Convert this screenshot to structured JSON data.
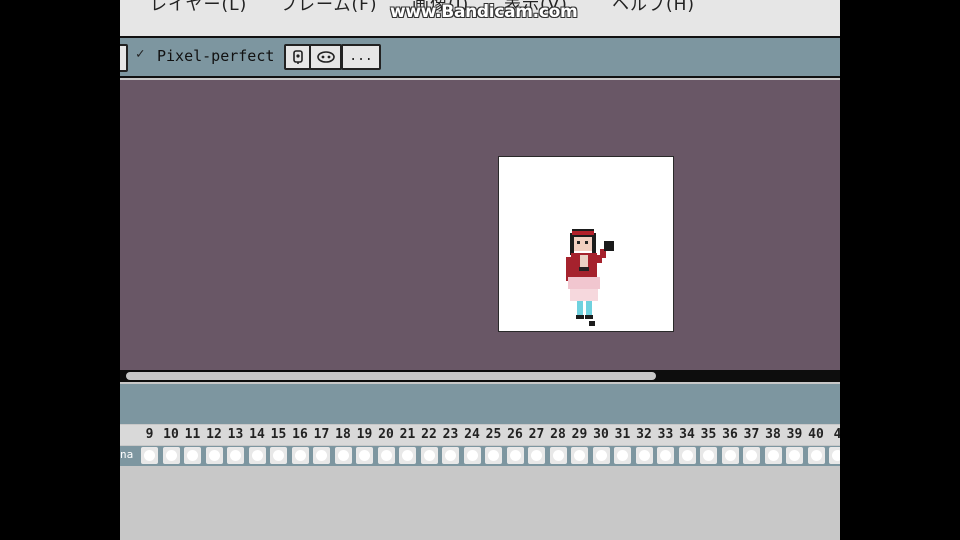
{
  "menu": {
    "items": [
      {
        "label": "レイヤー(L)"
      },
      {
        "label": "フレーム(F)"
      },
      {
        "label": "画像(I)"
      },
      {
        "label": "表示(V)"
      },
      {
        "label": "ヘルプ(H)"
      }
    ]
  },
  "watermark": "www.Bandicam.com",
  "context_bar": {
    "pixel_perfect_checked": true,
    "check_glyph": "✓",
    "pixel_perfect_label": "Pixel-perfect",
    "more_label": "..."
  },
  "timeline": {
    "row_label": "na",
    "frames": [
      "9",
      "10",
      "11",
      "12",
      "13",
      "14",
      "15",
      "16",
      "17",
      "18",
      "19",
      "20",
      "21",
      "22",
      "23",
      "24",
      "25",
      "26",
      "27",
      "28",
      "29",
      "30",
      "31",
      "32",
      "33",
      "34",
      "35",
      "36",
      "37",
      "38",
      "39",
      "40",
      "4"
    ]
  },
  "colors": {
    "canvas_bg": "#695766",
    "toolbar": "#7d96a0",
    "sprite_bg": "#ffffff"
  }
}
